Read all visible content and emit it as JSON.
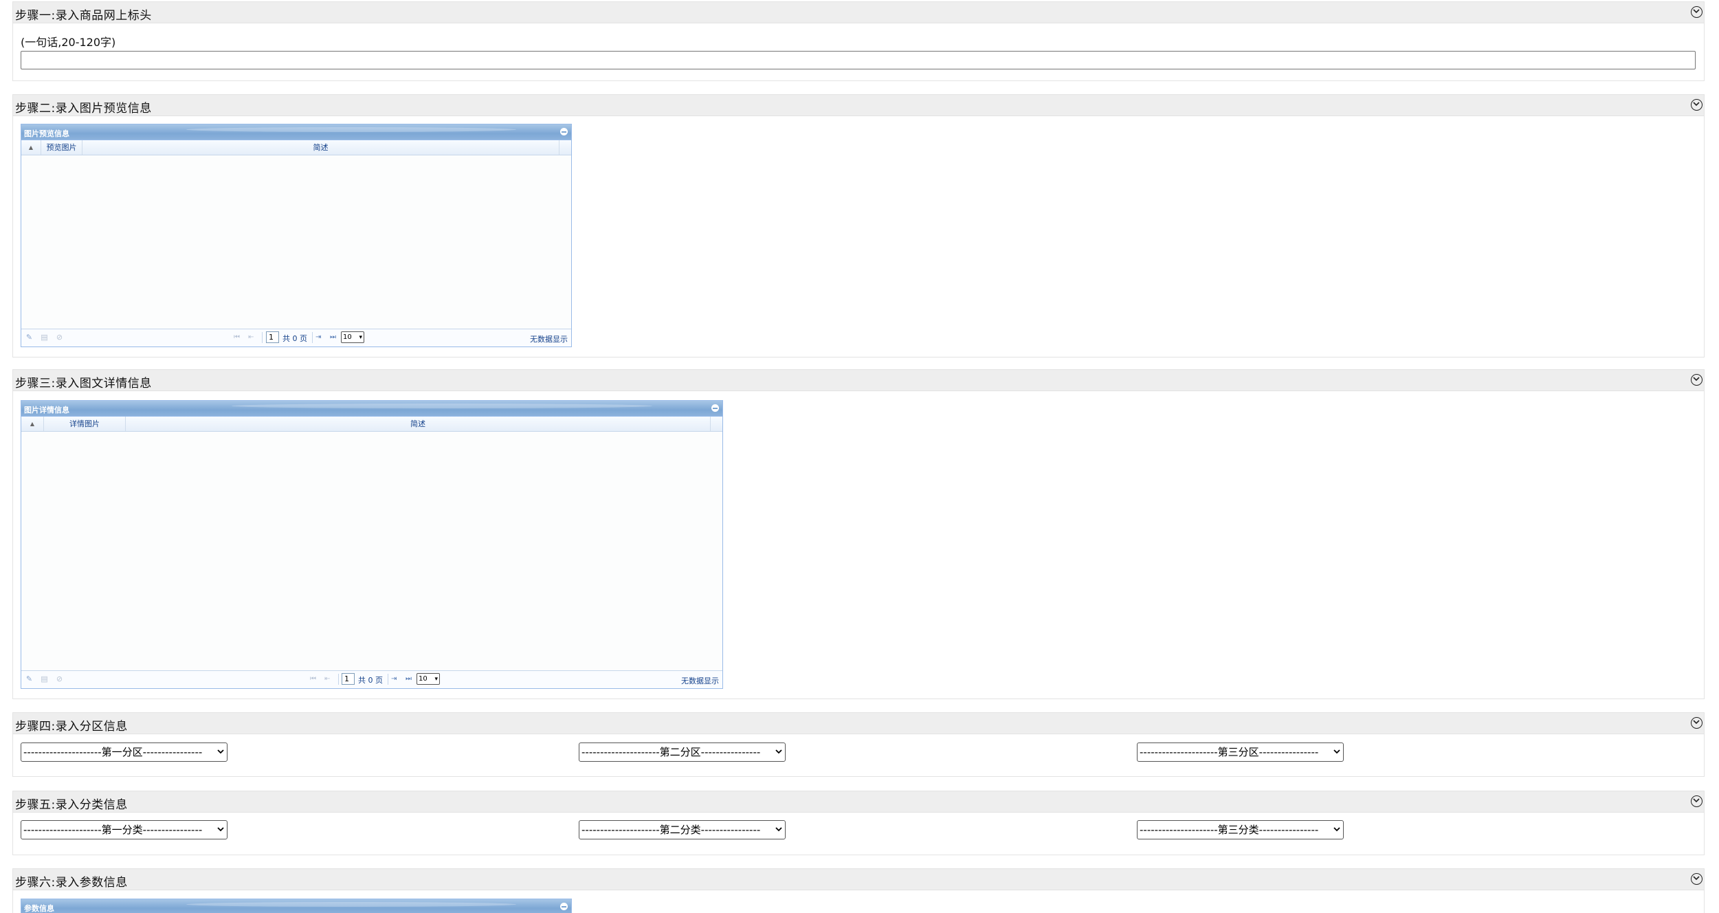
{
  "steps": [
    {
      "title": "步骤一:录入商品网上标头"
    },
    {
      "title": "步骤二:录入图片预览信息"
    },
    {
      "title": "步骤三:录入图文详情信息"
    },
    {
      "title": "步骤四:录入分区信息"
    },
    {
      "title": "步骤五:录入分类信息"
    },
    {
      "title": "步骤六:录入参数信息"
    }
  ],
  "step1": {
    "hint": "(一句话,20-120字)",
    "input_value": ""
  },
  "preview_grid": {
    "title": "图片预览信息",
    "columns": [
      "预览图片",
      "简述"
    ],
    "page_value": "1",
    "page_total": "共 0 页",
    "page_size": "10",
    "status": "无数据显示"
  },
  "detail_grid": {
    "title": "图片详情信息",
    "columns": [
      "详情图片",
      "简述"
    ],
    "page_value": "1",
    "page_total": "共 0 页",
    "page_size": "10",
    "status": "无数据显示"
  },
  "param_grid": {
    "title": "参数信息"
  },
  "zones": {
    "first": "---------------------第一分区----------------",
    "second": "---------------------第二分区----------------",
    "third": "---------------------第三分区----------------"
  },
  "categories": {
    "first": "---------------------第一分类----------------",
    "second": "---------------------第二分类----------------",
    "third": "---------------------第三分类----------------"
  },
  "icons": {
    "collapse": "chevron-down-circle-icon",
    "edit": "pencil-icon",
    "delete": "trash-icon",
    "refresh": "refresh-icon"
  }
}
